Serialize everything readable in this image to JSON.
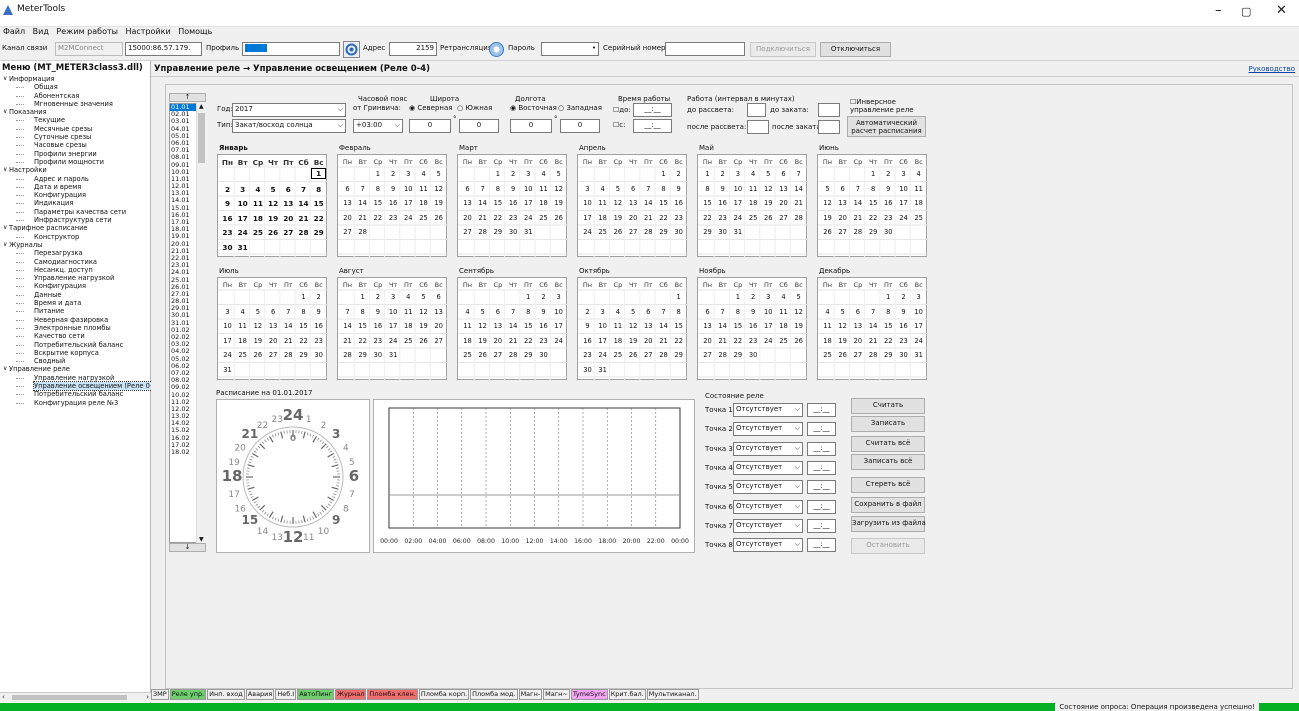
{
  "app": {
    "title": "MeterTools"
  },
  "menu": [
    "Файл",
    "Вид",
    "Режим работы",
    "Настройки",
    "Помощь"
  ],
  "toolbar": {
    "channel_label": "Канал связи",
    "channel_value": "M2MConnect",
    "channel_addr": "15000:86.57.179.",
    "profile_label": "Профиль",
    "address_label": "Адрес",
    "address_value": "2159",
    "relay_label": "Ретрансляция",
    "password_label": "Пароль",
    "password_value": "•",
    "serial_label": "Серийный номер",
    "serial_value": "",
    "connect": "Подключиться",
    "disconnect": "Отключиться"
  },
  "sidebar": {
    "title": "Меню (MT_METER3class3.dll)",
    "tree": [
      {
        "t": "Информация",
        "lvl": 0
      },
      {
        "t": "Общая",
        "lvl": 1
      },
      {
        "t": "Абонентская",
        "lvl": 1
      },
      {
        "t": "Мгновенные значения",
        "lvl": 1
      },
      {
        "t": "Показания",
        "lvl": 0
      },
      {
        "t": "Текущие",
        "lvl": 1
      },
      {
        "t": "Месячные срезы",
        "lvl": 1
      },
      {
        "t": "Суточные срезы",
        "lvl": 1
      },
      {
        "t": "Часовые срезы",
        "lvl": 1
      },
      {
        "t": "Профили энергии",
        "lvl": 1
      },
      {
        "t": "Профили мощности",
        "lvl": 1
      },
      {
        "t": "Настройки",
        "lvl": 0
      },
      {
        "t": "Адрес и пароль",
        "lvl": 1
      },
      {
        "t": "Дата и время",
        "lvl": 1
      },
      {
        "t": "Конфигурация",
        "lvl": 1
      },
      {
        "t": "Индикация",
        "lvl": 1
      },
      {
        "t": "Параметры качества сети",
        "lvl": 1
      },
      {
        "t": "Инфраструктура сети",
        "lvl": 1
      },
      {
        "t": "Тарифное расписание",
        "lvl": 0
      },
      {
        "t": "Конструктор",
        "lvl": 1
      },
      {
        "t": "Журналы",
        "lvl": 0
      },
      {
        "t": "Перезагрузка",
        "lvl": 1
      },
      {
        "t": "Самодиагностика",
        "lvl": 1
      },
      {
        "t": "Несанкц. доступ",
        "lvl": 1
      },
      {
        "t": "Управление нагрузкой",
        "lvl": 1
      },
      {
        "t": "Конфигурация",
        "lvl": 1
      },
      {
        "t": "Данные",
        "lvl": 1
      },
      {
        "t": "Время и дата",
        "lvl": 1
      },
      {
        "t": "Питание",
        "lvl": 1
      },
      {
        "t": "Неверная фазировка",
        "lvl": 1
      },
      {
        "t": "Электронные пломбы",
        "lvl": 1
      },
      {
        "t": "Качество сети",
        "lvl": 1
      },
      {
        "t": "Потребительский баланс",
        "lvl": 1
      },
      {
        "t": "Вскрытие корпуса",
        "lvl": 1
      },
      {
        "t": "Сводный",
        "lvl": 1
      },
      {
        "t": "Управление реле",
        "lvl": 0
      },
      {
        "t": "Управление нагрузкой",
        "lvl": 1
      },
      {
        "t": "Управление освещением (Реле 0-",
        "lvl": 1,
        "sel": true
      },
      {
        "t": "Потребительский баланс",
        "lvl": 1
      },
      {
        "t": "Конфигурация реле №3",
        "lvl": 1
      }
    ]
  },
  "page": {
    "title": "Управление реле → Управление освещением (Реле 0-4)",
    "guide": "Руководство"
  },
  "dates": [
    "01.01",
    "02.01",
    "03.01",
    "04.01",
    "05.01",
    "06.01",
    "07.01",
    "08.01",
    "09.01",
    "10.01",
    "11.01",
    "12.01",
    "13.01",
    "14.01",
    "15.01",
    "16.01",
    "17.01",
    "18.01",
    "19.01",
    "20.01",
    "21.01",
    "22.01",
    "23.01",
    "24.01",
    "25.01",
    "26.01",
    "27.01",
    "28.01",
    "29.01",
    "30.01",
    "31.01",
    "01.02",
    "02.02",
    "03.02",
    "04.02",
    "05.02",
    "06.02",
    "07.02",
    "08.02",
    "09.02",
    "10.02",
    "11.02",
    "12.02",
    "13.02",
    "14.02",
    "15.02",
    "16.02",
    "17.02",
    "18.02"
  ],
  "form": {
    "year_label": "Год:",
    "year": "2017",
    "type_label": "Тип:",
    "type": "Закат/восход солнца",
    "tz_label1": "Часовой пояс",
    "tz_label2": "от Гринвича:",
    "tz": "+03:00",
    "lat_label": "Широта",
    "north": "Северная",
    "south": "Южная",
    "lat_deg": "0",
    "lat_min": "0",
    "deg": "°",
    "lon_label": "Долгота",
    "east": "Восточная",
    "west": "Западная",
    "lon_deg": "0",
    "lon_min": "0",
    "worktime": "Время работы",
    "to": "до:",
    "from": "с:",
    "time_ph": "__:__",
    "interval": "Работа (интервал в минутах)",
    "before_sunrise": "до рассвета:",
    "before_sunset": "до заката:",
    "after_sunrise": "после рассвета:",
    "after_sunset": "после заката:",
    "inverse": "Инверсное управление реле",
    "autocalc": "Автоматический расчет расписания"
  },
  "weekdays": [
    "Пн",
    "Вт",
    "Ср",
    "Чт",
    "Пт",
    "Сб",
    "Вс"
  ],
  "months": [
    {
      "n": "Январь",
      "s": 6,
      "d": 31
    },
    {
      "n": "Февраль",
      "s": 2,
      "d": 28
    },
    {
      "n": "Март",
      "s": 2,
      "d": 31
    },
    {
      "n": "Апрель",
      "s": 5,
      "d": 30
    },
    {
      "n": "Май",
      "s": 0,
      "d": 31
    },
    {
      "n": "Июнь",
      "s": 3,
      "d": 30
    },
    {
      "n": "Июль",
      "s": 5,
      "d": 31
    },
    {
      "n": "Август",
      "s": 1,
      "d": 31
    },
    {
      "n": "Сентябрь",
      "s": 4,
      "d": 30
    },
    {
      "n": "Октябрь",
      "s": 6,
      "d": 31
    },
    {
      "n": "Ноябрь",
      "s": 2,
      "d": 30
    },
    {
      "n": "Декабрь",
      "s": 4,
      "d": 31
    }
  ],
  "schedule_label": "Расписание на 01.01.2017",
  "clock_labels": [
    "24",
    "1",
    "2",
    "3",
    "4",
    "5",
    "6",
    "7",
    "8",
    "9",
    "10",
    "11",
    "12",
    "13",
    "14",
    "15",
    "16",
    "17",
    "18",
    "19",
    "20",
    "21",
    "22",
    "23"
  ],
  "clock_inner": "0",
  "chart_x": [
    "00:00",
    "02:00",
    "04:00",
    "06:00",
    "08:00",
    "10:00",
    "12:00",
    "14:00",
    "16:00",
    "18:00",
    "20:00",
    "22:00",
    "00:00"
  ],
  "relay": {
    "title": "Состояние реле",
    "points": [
      "Точка 1:",
      "Точка 2:",
      "Точка 3:",
      "Точка 4:",
      "Точка 5:",
      "Точка 6:",
      "Точка 7:",
      "Точка 8:"
    ],
    "state": "Отсутствует",
    "time": "__:__",
    "buttons": [
      "Считать",
      "Записать",
      "Считать всё",
      "Записать всё",
      "Стереть всё",
      "Сохранить в файл",
      "Загрузить из файла",
      "Остановить"
    ]
  },
  "tabs": [
    {
      "t": "ЗМР",
      "c": ""
    },
    {
      "t": "Реле упр.",
      "c": "g"
    },
    {
      "t": "Инп. вход",
      "c": ""
    },
    {
      "t": "Авария",
      "c": ""
    },
    {
      "t": "Неб.I",
      "c": ""
    },
    {
      "t": "АвтоПинг",
      "c": "g"
    },
    {
      "t": "Журнал",
      "c": "r"
    },
    {
      "t": "Пломба клен.",
      "c": "r"
    },
    {
      "t": "Пломба корп.",
      "c": ""
    },
    {
      "t": "Пломба мод.",
      "c": ""
    },
    {
      "t": "Магн-",
      "c": ""
    },
    {
      "t": "Магн~",
      "c": ""
    },
    {
      "t": "TymeSync",
      "c": "p"
    },
    {
      "t": "Крит.бал.",
      "c": ""
    },
    {
      "t": "Мультиканал.",
      "c": ""
    }
  ],
  "statusbar": "Состояние опроса: Операция произведена успешно!"
}
